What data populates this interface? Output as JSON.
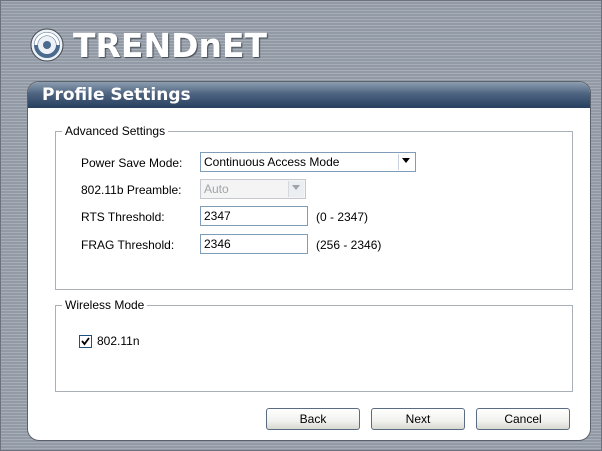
{
  "brand": {
    "logo_text": "TRENDnET",
    "logo_icon": "trendnet-swirl-logo"
  },
  "panel": {
    "title": "Profile Settings"
  },
  "advanced": {
    "legend": "Advanced Settings",
    "power_save": {
      "label": "Power Save Mode:",
      "value": "Continuous Access Mode"
    },
    "preamble": {
      "label": "802.11b Preamble:",
      "value": "Auto",
      "disabled": true
    },
    "rts": {
      "label": "RTS Threshold:",
      "value": "2347",
      "range": "(0 - 2347)"
    },
    "frag": {
      "label": "FRAG Threshold:",
      "value": "2346",
      "range": "(256 - 2346)"
    }
  },
  "wireless_mode": {
    "legend": "Wireless Mode",
    "option": {
      "label": "802.11n",
      "checked": true
    }
  },
  "buttons": {
    "back": "Back",
    "next": "Next",
    "cancel": "Cancel"
  },
  "colors": {
    "titlebar": "#26405f",
    "panel_bg": "#ffffff",
    "window_bg": "#9aa1ab"
  }
}
